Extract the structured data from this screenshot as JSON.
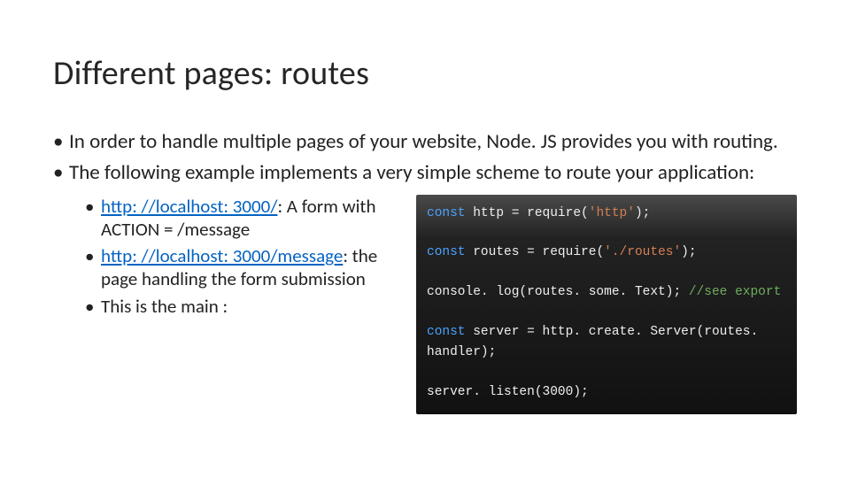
{
  "title": "Different pages: routes",
  "bullets": [
    "In order to handle multiple pages of your website, Node. JS provides you with routing.",
    "The following example implements a very simple scheme to route your application:"
  ],
  "sub": [
    {
      "link": "http: //localhost: 3000/",
      "rest": ": A form with ACTION = /message"
    },
    {
      "link": "http: //localhost: 3000/message",
      "rest": ": the page handling the form submission"
    },
    {
      "plain": "This is the main :"
    }
  ],
  "code": {
    "l1": {
      "kw": "const",
      "a": " http = require(",
      "s": "'http'",
      "b": ");"
    },
    "l2": {
      "kw": "const",
      "a": " routes = require(",
      "s": "'./routes'",
      "b": ");"
    },
    "l3": {
      "a": "console. log(routes. some. Text); ",
      "c": "//see export"
    },
    "l4": {
      "kw": "const",
      "a": " server = http. create. Server(routes. handler);"
    },
    "l5": {
      "a": "server. listen(3000);"
    }
  }
}
